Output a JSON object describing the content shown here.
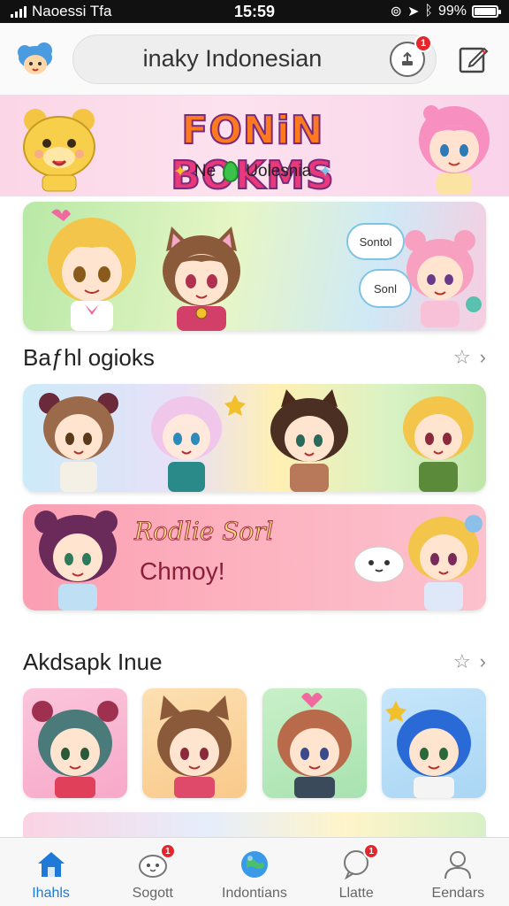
{
  "status_bar": {
    "carrier": "Naoessi Tfa",
    "time": "15:59",
    "battery_percent": "99%",
    "battery_level": 0.99
  },
  "top_bar": {
    "search_value": "inaky Indonesian",
    "upload_badge": "1",
    "icons": [
      "cloud-mascot-icon",
      "upload-icon",
      "edit-icon"
    ]
  },
  "hero": {
    "title_part1": "FONiN",
    "title_part2": "BOKMS",
    "subtitle_left": "Ne",
    "subtitle_right": "Uolesnia"
  },
  "featured": {
    "bubble_1": "Sontol",
    "bubble_2": "Sonl"
  },
  "section_1": {
    "title": "Baƒhl ogioks"
  },
  "promo": {
    "title": "Rodlie Sorl",
    "subtitle": "Chmoy!"
  },
  "section_2": {
    "title": "Akdsapk Inue"
  },
  "tab_bar": {
    "tabs": [
      {
        "label": "Ihahls",
        "icon": "home-icon",
        "badge": ""
      },
      {
        "label": "Sogott",
        "icon": "mascot-icon",
        "badge": "1"
      },
      {
        "label": "Indontians",
        "icon": "globe-icon",
        "badge": ""
      },
      {
        "label": "Llatte",
        "icon": "chat-icon",
        "badge": "1"
      },
      {
        "label": "Eendars",
        "icon": "profile-icon",
        "badge": ""
      }
    ]
  },
  "colors": {
    "accent_blue": "#1e7ad6",
    "badge_red": "#e5262c",
    "hero_pink": "#fbd6e6"
  }
}
